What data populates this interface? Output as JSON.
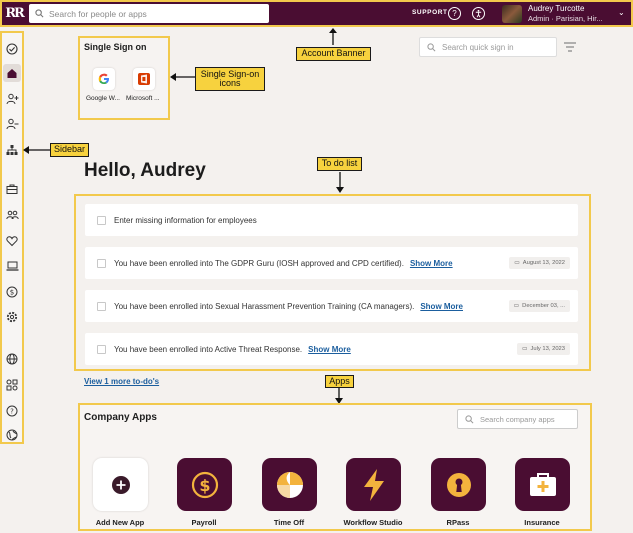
{
  "topbar": {
    "logo": "RR",
    "search_placeholder": "Search for people or apps",
    "support_label": "SUPPORT",
    "user_name": "Audrey Turcotte",
    "user_role": "Admin · Parisian, Hir..."
  },
  "sidebar": {
    "items": [
      "check-circle-icon",
      "home-icon",
      "add-person-icon",
      "remove-person-icon",
      "org-chart-icon",
      "briefcase-icon",
      "people-icon",
      "heart-icon",
      "laptop-icon",
      "dollar-icon",
      "settings-icon",
      "globe-icon",
      "apps-icon",
      "help-icon",
      "global-icon"
    ]
  },
  "callouts": {
    "account_banner": "Account Banner",
    "sso_icons": "Single Sign-on icons",
    "sidebar": "Sidebar",
    "todo": "To do list",
    "apps": "Apps"
  },
  "sso": {
    "title": "Single Sign on",
    "apps": [
      {
        "label": "Google W...",
        "icon": "google-icon"
      },
      {
        "label": "Microsoft ...",
        "icon": "microsoft-office-icon"
      }
    ],
    "quick_search_placeholder": "Search quick sign in"
  },
  "greeting": "Hello, Audrey",
  "todos": [
    {
      "text": "Enter missing information for employees",
      "link": "",
      "date": ""
    },
    {
      "text": "You have been enrolled into The GDPR Guru (IOSH approved and CPD certified).",
      "link": "Show More",
      "date": "August 13, 2022"
    },
    {
      "text": "You have been enrolled into Sexual Harassment Prevention Training (CA managers).",
      "link": "Show More",
      "date": "December 03, ..."
    },
    {
      "text": "You have been enrolled into Active Threat Response.",
      "link": "Show More",
      "date": "July 13, 2023"
    }
  ],
  "view_more": "View 1 more to-do's",
  "company_apps": {
    "title": "Company Apps",
    "search_placeholder": "Search company apps",
    "apps": [
      {
        "label": "Add New App",
        "icon": "plus-icon"
      },
      {
        "label": "Payroll",
        "icon": "dollar-coin-icon"
      },
      {
        "label": "Time Off",
        "icon": "beach-ball-icon"
      },
      {
        "label": "Workflow Studio",
        "icon": "lightning-icon"
      },
      {
        "label": "RPass",
        "icon": "keyhole-icon"
      },
      {
        "label": "Insurance",
        "icon": "first-aid-kit-icon"
      }
    ]
  },
  "colors": {
    "brand": "#4a0d32",
    "highlight": "#f2c94c",
    "callout": "#f7d23e",
    "link": "#1b5e9e"
  }
}
